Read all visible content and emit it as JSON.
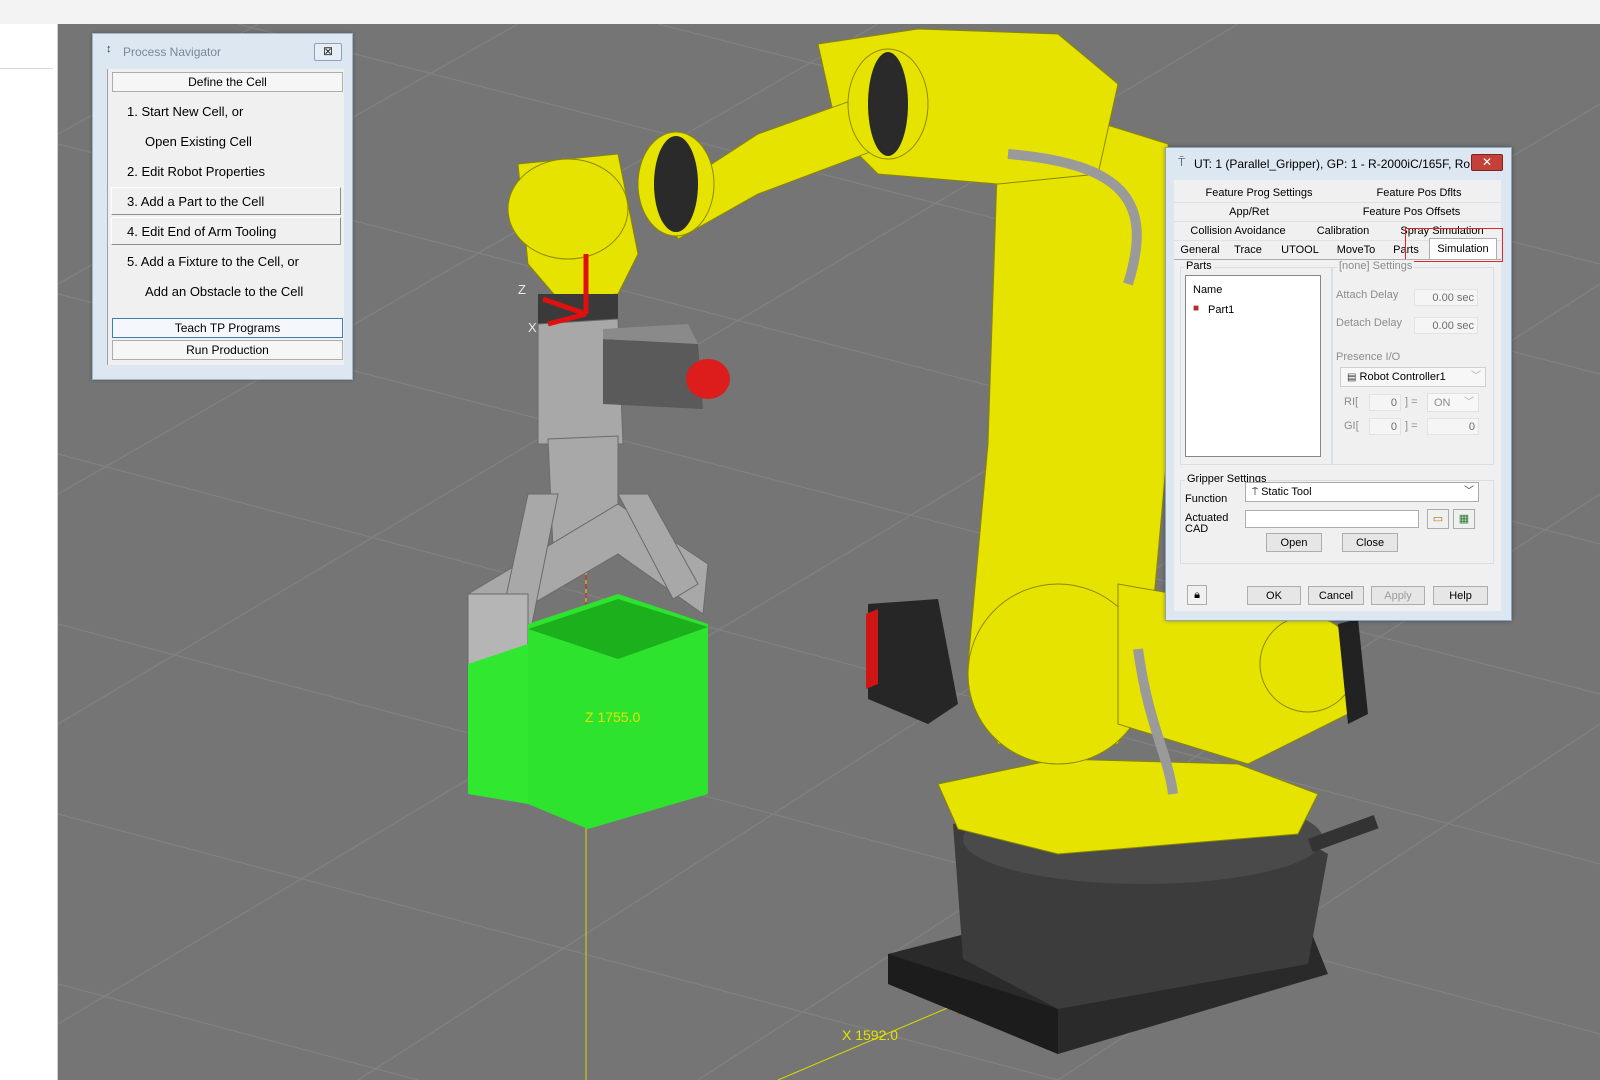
{
  "process_navigator": {
    "title": "Process Navigator",
    "close_glyph": "⊠",
    "define_cell_label": "Define the Cell",
    "steps": [
      "1.  Start New Cell, or",
      "Open Existing Cell",
      "2.  Edit Robot Properties",
      "3.  Add a Part to the Cell",
      "4.  Edit End of Arm Tooling",
      "5.  Add a Fixture to the Cell, or",
      "Add an Obstacle to the Cell"
    ],
    "teach_label": "Teach TP Programs",
    "run_label": "Run Production"
  },
  "ut_dialog": {
    "title": "UT: 1  (Parallel_Gripper), GP: 1 - R-2000iC/165F, Ro...",
    "close_glyph": "✕",
    "tabs": {
      "row1": [
        "Feature Prog Settings",
        "Feature Pos Dflts"
      ],
      "row2": [
        "App/Ret",
        "Feature Pos Offsets"
      ],
      "row3": [
        "Collision Avoidance",
        "Calibration",
        "Spray Simulation"
      ],
      "row4": [
        "General",
        "Trace",
        "UTOOL",
        "MoveTo",
        "Parts",
        "Simulation"
      ]
    },
    "active_tab": "Simulation",
    "parts_group_label": "Parts",
    "parts_list_header": "Name",
    "parts_list_items": [
      "Part1"
    ],
    "settings_group_label": "[none] Settings",
    "attach_delay_label": "Attach Delay",
    "attach_delay_value": "0.00 sec",
    "detach_delay_label": "Detach Delay",
    "detach_delay_value": "0.00 sec",
    "presence_io_label": "Presence I/O",
    "controller_value": "Robot Controller1",
    "ri_label": "RI[",
    "ri_index": "0",
    "ri_eq": "] =",
    "ri_value": "ON",
    "gi_label": "GI[",
    "gi_index": "0",
    "gi_eq": "] =",
    "gi_value": "0",
    "gripper_group_label": "Gripper Settings",
    "function_label": "Function",
    "function_value": "Static Tool",
    "actuated_cad_label_1": "Actuated",
    "actuated_cad_label_2": "CAD",
    "actuated_cad_value": "",
    "open_label": "Open",
    "close_label": "Close",
    "ok_label": "OK",
    "cancel_label": "Cancel",
    "apply_label": "Apply",
    "help_label": "Help"
  },
  "viewport": {
    "z_readout": "Z 1755.0",
    "x_readout": "X 1592.0",
    "axis_z": "Z",
    "axis_x": "X",
    "robot_color": "#e7e300",
    "part_color": "#22ee22",
    "floor_color": "#757575"
  }
}
